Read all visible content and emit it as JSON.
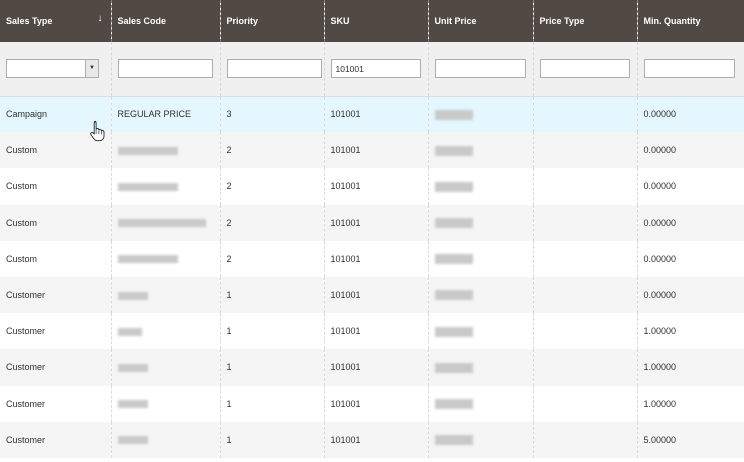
{
  "columns": [
    "Sales Type",
    "Sales Code",
    "Priority",
    "SKU",
    "Unit Price",
    "Price Type",
    "Min. Quantity"
  ],
  "sort_indicator": "↓",
  "filters": {
    "sales_type": "",
    "sales_code": "",
    "priority": "",
    "sku": "101001",
    "unit_price": "",
    "price_type": "",
    "min_quantity": ""
  },
  "rows": [
    {
      "sales_type": "Campaign",
      "sales_code": "REGULAR PRICE",
      "priority": "3",
      "sku": "101001",
      "price_type": "",
      "min_quantity": "0.00000"
    },
    {
      "sales_type": "Custom",
      "sales_code": "",
      "priority": "2",
      "sku": "101001",
      "price_type": "",
      "min_quantity": "0.00000"
    },
    {
      "sales_type": "Custom",
      "sales_code": "",
      "priority": "2",
      "sku": "101001",
      "price_type": "",
      "min_quantity": "0.00000"
    },
    {
      "sales_type": "Custom",
      "sales_code": "",
      "priority": "2",
      "sku": "101001",
      "price_type": "",
      "min_quantity": "0.00000"
    },
    {
      "sales_type": "Custom",
      "sales_code": "",
      "priority": "2",
      "sku": "101001",
      "price_type": "",
      "min_quantity": "0.00000"
    },
    {
      "sales_type": "Customer",
      "sales_code": "",
      "priority": "1",
      "sku": "101001",
      "price_type": "",
      "min_quantity": "0.00000"
    },
    {
      "sales_type": "Customer",
      "sales_code": "",
      "priority": "1",
      "sku": "101001",
      "price_type": "",
      "min_quantity": "1.00000"
    },
    {
      "sales_type": "Customer",
      "sales_code": "",
      "priority": "1",
      "sku": "101001",
      "price_type": "",
      "min_quantity": "1.00000"
    },
    {
      "sales_type": "Customer",
      "sales_code": "",
      "priority": "1",
      "sku": "101001",
      "price_type": "",
      "min_quantity": "1.00000"
    },
    {
      "sales_type": "Customer",
      "sales_code": "",
      "priority": "1",
      "sku": "101001",
      "price_type": "",
      "min_quantity": "5.00000"
    }
  ],
  "colors": {
    "header_bg": "#514943",
    "filter_bg": "#f0f0f0",
    "row_hover": "#e5f7fe",
    "row_even": "#f5f5f5"
  },
  "icons": {
    "sort": "sort-down-arrow-icon",
    "cursor": "hand-pointer-cursor-icon",
    "dropdown": "chevron-down-icon"
  }
}
